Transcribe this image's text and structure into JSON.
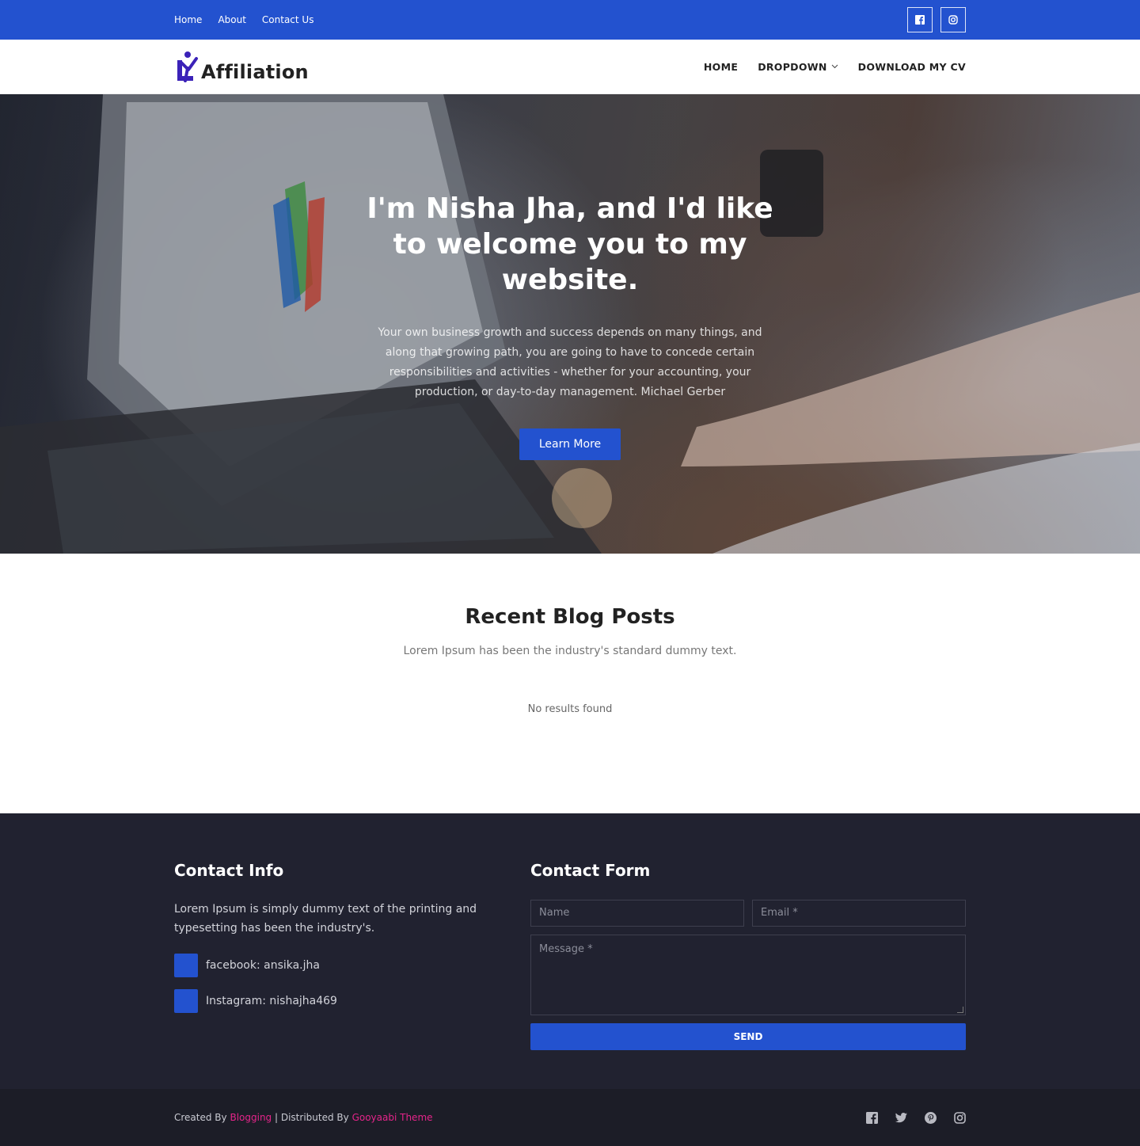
{
  "topbar": {
    "links": [
      "Home",
      "About",
      "Contact Us"
    ],
    "social": [
      "facebook-icon",
      "instagram-icon"
    ]
  },
  "header": {
    "logo_text": "Affiliation",
    "nav": {
      "home": "HOME",
      "dropdown": "DROPDOWN",
      "cv": "DOWNLOAD MY CV"
    }
  },
  "hero": {
    "title": "I'm Nisha Jha, and I'd like to welcome you to my website.",
    "text": "Your own business growth and success depends on many things, and along that growing path, you are going to have to concede certain responsibilities and activities - whether for your accounting, your production, or day-to-day management. Michael Gerber",
    "button": "Learn More"
  },
  "blog": {
    "title": "Recent Blog Posts",
    "subtitle": "Lorem Ipsum has been the industry's standard dummy text.",
    "empty": "No results found"
  },
  "contact_info": {
    "title": "Contact Info",
    "text": "Lorem Ipsum is simply dummy text of the printing and typesetting has been the industry's.",
    "items": [
      "facebook: ansika.jha",
      "Instagram: nishajha469"
    ]
  },
  "contact_form": {
    "title": "Contact Form",
    "name_placeholder": "Name",
    "email_placeholder": "Email *",
    "message_placeholder": "Message *",
    "send": "SEND"
  },
  "footer": {
    "created_by": "Created By",
    "blogging": "Blogging",
    "distributed_by": "| Distributed By",
    "theme": "Gooyaabi Theme",
    "social": [
      "facebook-icon",
      "twitter-icon",
      "pinterest-icon",
      "instagram-icon"
    ]
  },
  "colors": {
    "primary": "#2352cf",
    "dark": "#212230",
    "footer": "#1c1d27",
    "link_pink": "#e5248a"
  }
}
